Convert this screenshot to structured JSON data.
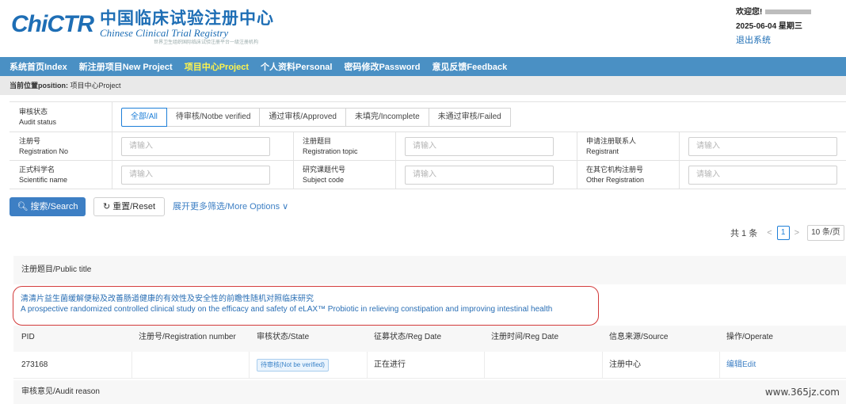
{
  "brand": {
    "logo_mark": "ChiCTR",
    "title_cn": "中国临床试验注册中心",
    "title_en": "Chinese Clinical Trial Registry",
    "subtitle": "世界卫生组织国际临床试验注册平台一级注册机构"
  },
  "user": {
    "welcome": "欢迎您!",
    "date": "2025-06-04 星期三",
    "logout": "退出系统"
  },
  "nav": {
    "items": [
      {
        "label": "系统首页Index",
        "active": false
      },
      {
        "label": "新注册项目New Project",
        "active": false
      },
      {
        "label": "项目中心Project",
        "active": true
      },
      {
        "label": "个人资料Personal",
        "active": false
      },
      {
        "label": "密码修改Password",
        "active": false
      },
      {
        "label": "意见反馈Feedback",
        "active": false
      }
    ]
  },
  "breadcrumb": {
    "label": "当前位置position:",
    "value": "项目中心Project"
  },
  "filter": {
    "audit_status": {
      "label_cn": "审核状态",
      "label_en": "Audit status",
      "options": [
        "全部/All",
        "待审核/Notbe verified",
        "通过审核/Approved",
        "未填完/Incomplete",
        "未通过审核/Failed"
      ],
      "selected": "全部/All"
    },
    "registration_no": {
      "label_cn": "注册号",
      "label_en": "Registration No",
      "placeholder": "请输入"
    },
    "registration_topic": {
      "label_cn": "注册题目",
      "label_en": "Registration topic",
      "placeholder": "请输入"
    },
    "registrant": {
      "label_cn": "申请注册联系人",
      "label_en": "Registrant",
      "placeholder": "请输入"
    },
    "scientific_name": {
      "label_cn": "正式科学名",
      "label_en": "Scientific name",
      "placeholder": "请输入"
    },
    "subject_code": {
      "label_cn": "研究课题代号",
      "label_en": "Subject code",
      "placeholder": "请输入"
    },
    "other_registration": {
      "label_cn": "在其它机构注册号",
      "label_en": "Other Registration",
      "placeholder": "请输入"
    }
  },
  "actions": {
    "search": "搜索/Search",
    "reset": "重置/Reset",
    "more_options": "展开更多筛选/More Options"
  },
  "pagination": {
    "total": "共 1 条",
    "current_page": "1",
    "page_size": "10 条/页"
  },
  "results": {
    "public_title_header": "注册题目/Public title",
    "title_cn": "清清片益生菌缓解便秘及改善肠道健康的有效性及安全性的前瞻性随机对照临床研究",
    "title_en": "A prospective randomized controlled clinical study on the efficacy and safety of eLAX™ Probiotic in relieving constipation and improving intestinal health",
    "columns": [
      "PID",
      "注册号/Registration number",
      "审核状态/State",
      "征募状态/Reg Date",
      "注册时间/Reg Date",
      "信息来源/Source",
      "操作/Operate"
    ],
    "row": {
      "pid": "273168",
      "registration_number": "",
      "state": "待审核(Not be verified)",
      "recruit_status": "正在进行",
      "reg_date": "",
      "source": "注册中心",
      "operate": "编辑Edit"
    },
    "audit_reason_header": "审核意见/Audit reason"
  },
  "watermark_url": "www.365jz.com",
  "colors": {
    "nav_bg": "#4a90c4",
    "nav_active": "#fff44d",
    "primary": "#1e7fd8",
    "highlight_border": "#d23a3a"
  }
}
